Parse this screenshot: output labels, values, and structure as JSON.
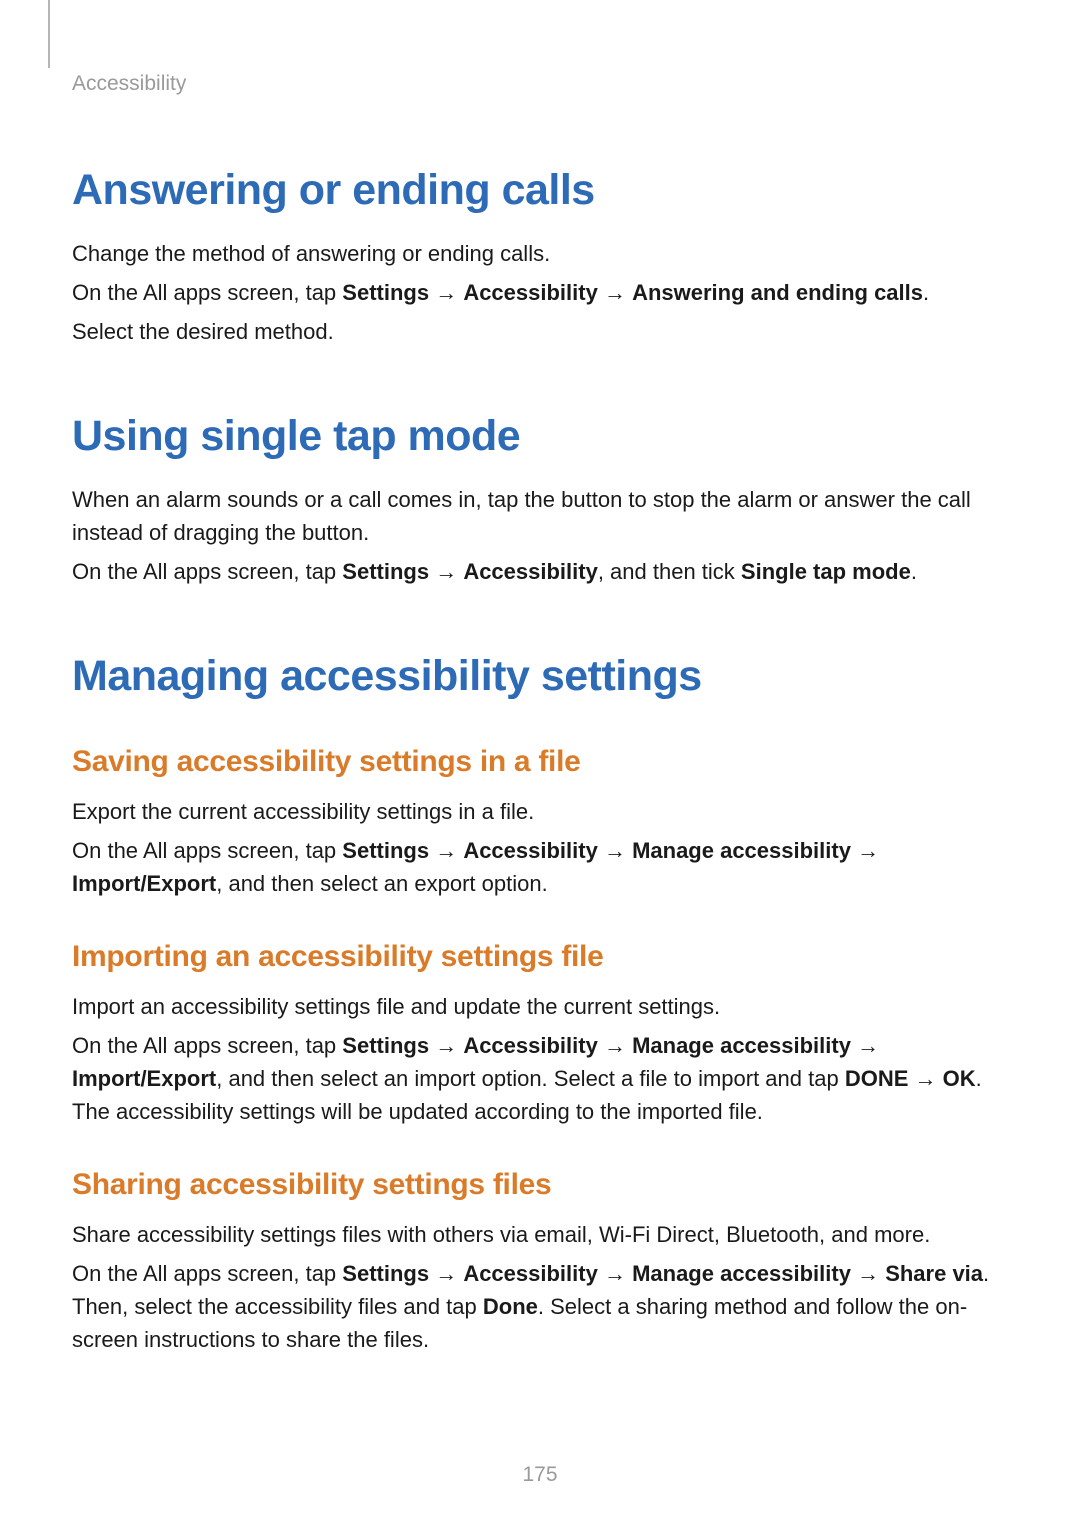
{
  "breadcrumb": "Accessibility",
  "page_number": "175",
  "sections": {
    "answering": {
      "title": "Answering or ending calls",
      "p1": "Change the method of answering or ending calls.",
      "p2_pre": "On the All apps screen, tap ",
      "p2_b1": "Settings",
      "p2_arrow1": " → ",
      "p2_b2": "Accessibility",
      "p2_arrow2": " → ",
      "p2_b3": "Answering and ending calls",
      "p2_post": ".",
      "p3": "Select the desired method."
    },
    "single_tap": {
      "title": "Using single tap mode",
      "p1": "When an alarm sounds or a call comes in, tap the button to stop the alarm or answer the call instead of dragging the button.",
      "p2_pre": "On the All apps screen, tap ",
      "p2_b1": "Settings",
      "p2_arrow1": " → ",
      "p2_b2": "Accessibility",
      "p2_mid": ", and then tick ",
      "p2_b3": "Single tap mode",
      "p2_post": "."
    },
    "managing": {
      "title": "Managing accessibility settings",
      "saving": {
        "title": "Saving accessibility settings in a file",
        "p1": "Export the current accessibility settings in a file.",
        "p2_pre": "On the All apps screen, tap ",
        "p2_b1": "Settings",
        "p2_a1": " → ",
        "p2_b2": "Accessibility",
        "p2_a2": " → ",
        "p2_b3": "Manage accessibility",
        "p2_a3": " → ",
        "p2_b4": "Import/Export",
        "p2_post": ", and then select an export option."
      },
      "importing": {
        "title": "Importing an accessibility settings file",
        "p1": "Import an accessibility settings file and update the current settings.",
        "p2_pre": "On the All apps screen, tap ",
        "p2_b1": "Settings",
        "p2_a1": " → ",
        "p2_b2": "Accessibility",
        "p2_a2": " → ",
        "p2_b3": "Manage accessibility",
        "p2_a3": " → ",
        "p2_b4": "Import/Export",
        "p2_mid": ", and then select an import option. Select a file to import and tap ",
        "p2_b5": "DONE",
        "p2_a4": " → ",
        "p2_b6": "OK",
        "p2_post": ". The accessibility settings will be updated according to the imported file."
      },
      "sharing": {
        "title": "Sharing accessibility settings files",
        "p1": "Share accessibility settings files with others via email, Wi-Fi Direct, Bluetooth, and more.",
        "p2_pre": "On the All apps screen, tap ",
        "p2_b1": "Settings",
        "p2_a1": " → ",
        "p2_b2": "Accessibility",
        "p2_a2": " → ",
        "p2_b3": "Manage accessibility",
        "p2_a3": " → ",
        "p2_b4": "Share via",
        "p2_mid": ". Then, select the accessibility files and tap ",
        "p2_b5": "Done",
        "p2_post": ". Select a sharing method and follow the on-screen instructions to share the files."
      }
    }
  }
}
